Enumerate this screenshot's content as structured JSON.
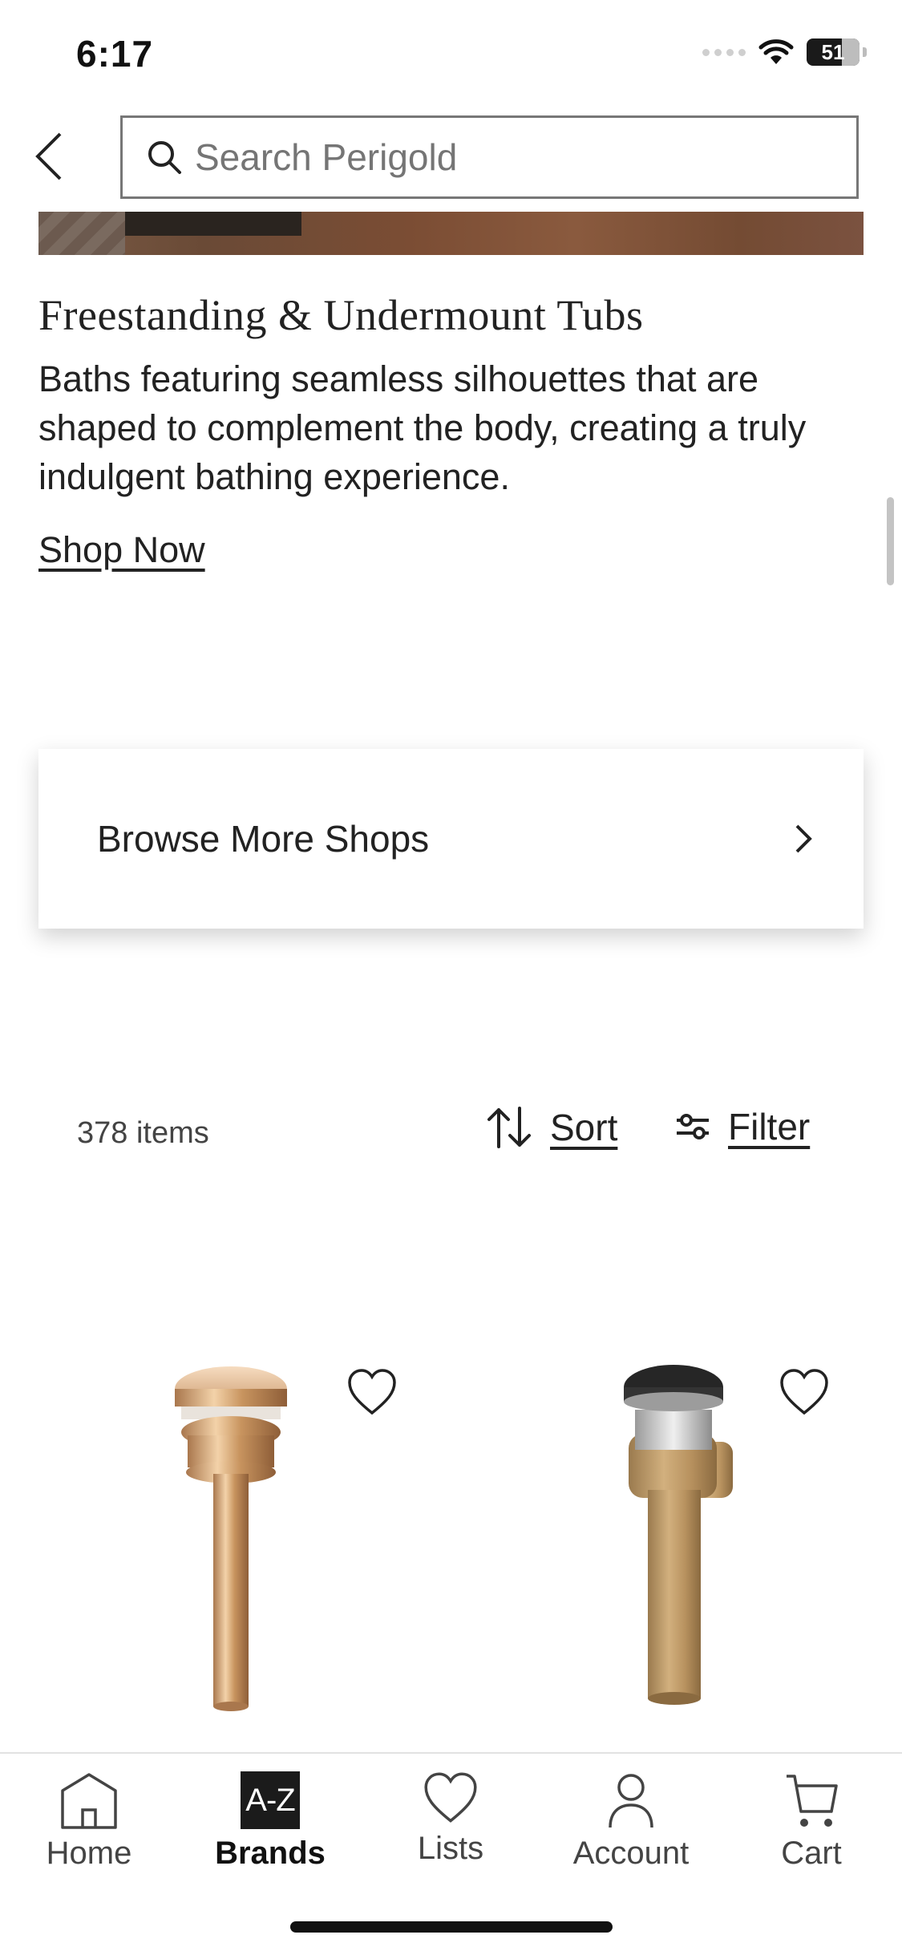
{
  "status_bar": {
    "time": "6:17",
    "battery": "51"
  },
  "header": {
    "search_placeholder": "Search Perigold"
  },
  "category": {
    "title": "Freestanding & Undermount Tubs",
    "description": "Baths featuring seamless silhouettes that are shaped to complement the body, creating a truly indulgent bathing experience.",
    "cta": "Shop Now"
  },
  "browse_card": {
    "label": "Browse More Shops"
  },
  "results": {
    "count": "378 items",
    "sort_label": "Sort",
    "filter_label": "Filter"
  },
  "products": [
    {
      "name": "gold pop-up drain",
      "favorited": false
    },
    {
      "name": "brass pop-up drain with overflow",
      "favorited": false
    }
  ],
  "bottom_nav": {
    "items": [
      {
        "label": "Home",
        "icon": "home-icon"
      },
      {
        "label": "Brands",
        "icon": "az-icon",
        "badge": "A-Z",
        "active": true
      },
      {
        "label": "Lists",
        "icon": "heart-icon"
      },
      {
        "label": "Account",
        "icon": "person-icon"
      },
      {
        "label": "Cart",
        "icon": "cart-icon"
      }
    ]
  },
  "colors": {
    "text": "#222222",
    "nav_active_bg": "#1b1b1b",
    "border": "#777777"
  }
}
